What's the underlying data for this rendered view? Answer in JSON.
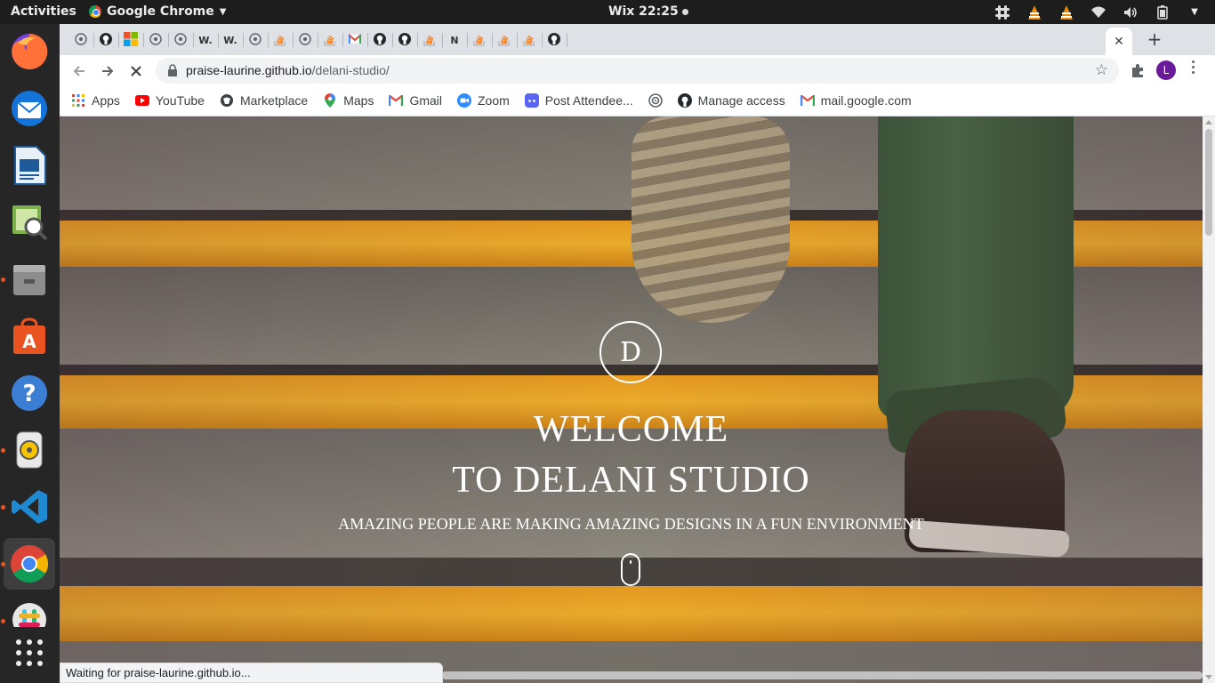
{
  "topbar": {
    "activities": "Activities",
    "app_name": "Google Chrome",
    "clock": "Wix 22:25"
  },
  "dock": {
    "items": [
      "firefox-icon",
      "thunderbird-icon",
      "libreoffice-impress-icon",
      "image-viewer-icon",
      "files-icon",
      "software-center-icon",
      "help-icon",
      "rhythmbox-icon",
      "vscode-icon",
      "chrome-icon",
      "slack-icon",
      "show-apps-icon"
    ]
  },
  "browser": {
    "tabs": [
      {
        "icon": "site-icon",
        "label": ""
      },
      {
        "icon": "github-icon",
        "label": ""
      },
      {
        "icon": "microsoft-icon",
        "label": ""
      },
      {
        "icon": "site-icon",
        "label": ""
      },
      {
        "icon": "site-icon",
        "label": ""
      },
      {
        "icon": "wix-icon",
        "label": "W."
      },
      {
        "icon": "wix-icon",
        "label": "W."
      },
      {
        "icon": "site-icon",
        "label": ""
      },
      {
        "icon": "stackoverflow-icon",
        "label": ""
      },
      {
        "icon": "site-icon",
        "label": ""
      },
      {
        "icon": "stackoverflow-icon",
        "label": ""
      },
      {
        "icon": "gmail-icon",
        "label": ""
      },
      {
        "icon": "github-icon",
        "label": ""
      },
      {
        "icon": "github-icon",
        "label": ""
      },
      {
        "icon": "stackoverflow-icon",
        "label": ""
      },
      {
        "icon": "notion-icon",
        "label": "N"
      },
      {
        "icon": "stackoverflow-icon",
        "label": ""
      },
      {
        "icon": "stackoverflow-icon",
        "label": ""
      },
      {
        "icon": "stackoverflow-icon",
        "label": ""
      },
      {
        "icon": "github-icon",
        "label": ""
      }
    ],
    "url_host": "praise-laurine.github.io",
    "url_path": "/delani-studio/",
    "profile_initial": "L",
    "bookmarks": [
      {
        "icon": "apps-grid-icon",
        "label": "Apps"
      },
      {
        "icon": "youtube-icon",
        "label": "YouTube"
      },
      {
        "icon": "marketplace-icon",
        "label": "Marketplace"
      },
      {
        "icon": "maps-icon",
        "label": "Maps"
      },
      {
        "icon": "gmail-icon",
        "label": "Gmail"
      },
      {
        "icon": "zoom-icon",
        "label": "Zoom"
      },
      {
        "icon": "discord-icon",
        "label": "Post Attendee..."
      },
      {
        "icon": "target-icon",
        "label": ""
      },
      {
        "icon": "github-icon",
        "label": "Manage access"
      },
      {
        "icon": "gmail-icon",
        "label": "mail.google.com"
      }
    ],
    "status": "Waiting for praise-laurine.github.io..."
  },
  "page": {
    "logo_letter": "D",
    "title_line1": "WELCOME",
    "title_line2": "TO DELANI STUDIO",
    "subtitle": "AMAZING PEOPLE ARE MAKING AMAZING DESIGNS IN A FUN ENVIRONMENT"
  },
  "colors": {
    "accent_stripe": "#f7b42e",
    "profile": "#6a1b9a",
    "topbar": "#1d1d1d"
  }
}
